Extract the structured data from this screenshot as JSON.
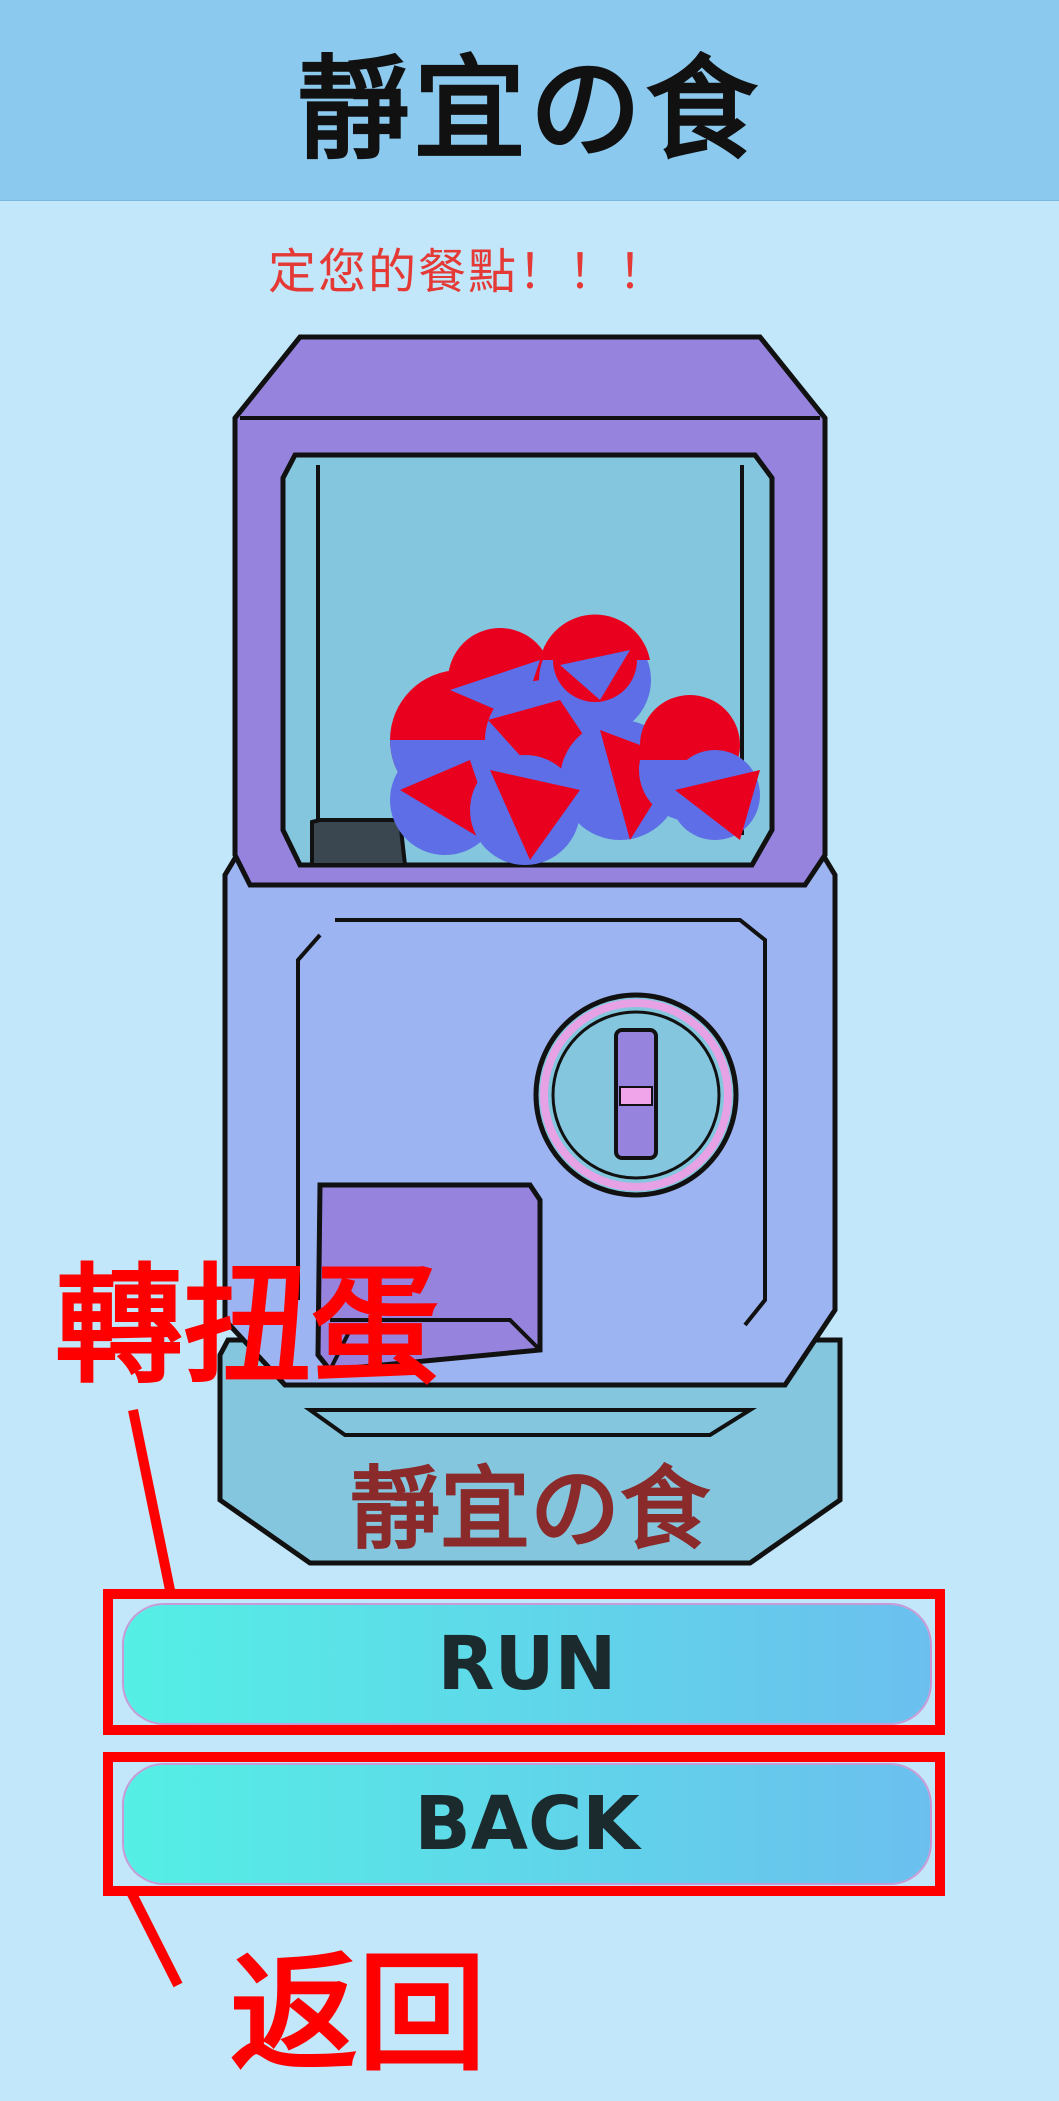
{
  "header": {
    "title": "靜宜の食"
  },
  "subtitle": "定您的餐點！！！",
  "machine": {
    "label": "靜宜の食"
  },
  "buttons": {
    "run_label": "RUN",
    "back_label": "BACK"
  },
  "annotations": {
    "run_note": "轉扭蛋",
    "back_note": "返回"
  },
  "colors": {
    "header_bg": "#8cc9ef",
    "page_bg": "#c2e7fa",
    "machine_top": "#9583de",
    "machine_body": "#9db4f2",
    "machine_base": "#84c6de",
    "capsule_red": "#e8001e",
    "capsule_blue": "#5d6ee6",
    "annotation_red": "#ff0000",
    "button_gradient_start": "#54efe5",
    "button_gradient_end": "#6bbfee"
  }
}
